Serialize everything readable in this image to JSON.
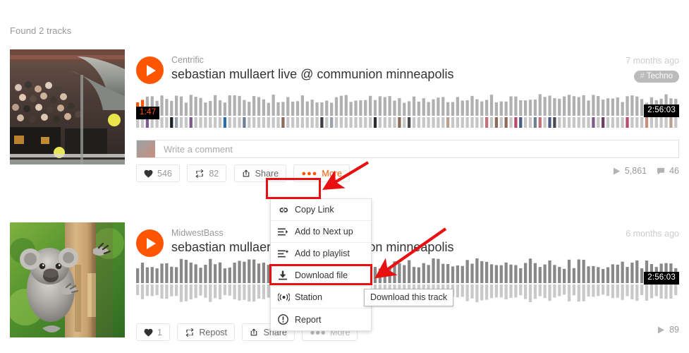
{
  "header": {
    "found_label": "Found 2 tracks"
  },
  "colors": {
    "accent_orange": "#ff5500",
    "annotation_red": "#e81010",
    "text_dark": "#333333",
    "text_muted": "#999999",
    "tag_bg": "#bbbbbb"
  },
  "tracks": [
    {
      "artwork_name": "crowd-festival-photo",
      "user": "Centrific",
      "title": "sebastian mullaert live @ communion minneapolis",
      "ago": "7 months ago",
      "tag": "Techno",
      "tag_hash": "#",
      "progress_time": "1:47",
      "duration": "2:56:03",
      "comment_placeholder": "Write a comment",
      "actions": [
        {
          "name": "like",
          "icon": "heart-icon",
          "label": "",
          "count": "546"
        },
        {
          "name": "repost",
          "icon": "repost-icon",
          "label": "",
          "count": "82"
        },
        {
          "name": "share",
          "icon": "share-icon",
          "label": "Share",
          "count": ""
        },
        {
          "name": "more",
          "icon": "dots-icon",
          "label": "More",
          "count": ""
        }
      ],
      "plays": "5,861",
      "comments": "46"
    },
    {
      "artwork_name": "koala-on-tree-photo",
      "user": "MidwestBass",
      "title": "sebastian mullaert live @ communion minneapolis",
      "ago": "6 months ago",
      "duration": "2:56:03",
      "actions": [
        {
          "name": "like",
          "icon": "heart-icon",
          "label": "",
          "count": "1"
        },
        {
          "name": "repost",
          "icon": "repost-icon",
          "label": "Repost",
          "count": ""
        },
        {
          "name": "share",
          "icon": "share-icon",
          "label": "Share",
          "count": ""
        },
        {
          "name": "more",
          "icon": "dots-icon",
          "label": "More",
          "count": ""
        }
      ],
      "plays": "89"
    }
  ],
  "dropdown": {
    "items": [
      {
        "icon": "link-icon",
        "label": "Copy Link"
      },
      {
        "icon": "queue-next-icon",
        "label": "Add to Next up"
      },
      {
        "icon": "playlist-add-icon",
        "label": "Add to playlist"
      },
      {
        "icon": "download-icon",
        "label": "Download file"
      },
      {
        "icon": "station-icon",
        "label": "Station"
      },
      {
        "icon": "report-icon",
        "label": "Report"
      }
    ]
  },
  "tooltip": {
    "text": "Download this track"
  }
}
